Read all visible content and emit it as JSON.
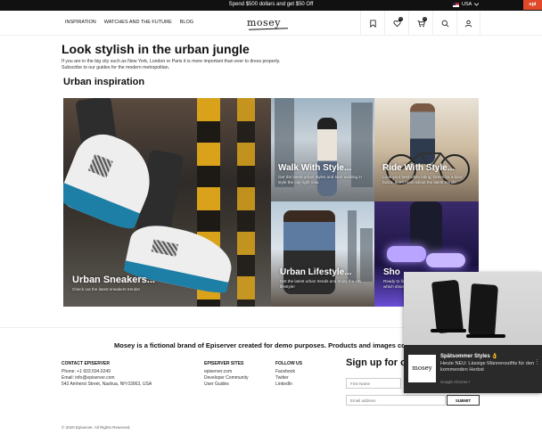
{
  "promo": {
    "text": "Spend $500 dollars and get $50 Off",
    "locale": "USA",
    "ext_badge": "epi"
  },
  "header": {
    "nav": [
      "INSPIRATION",
      "WATCHES AND THE FUTURE",
      "BLOG"
    ],
    "logo": "mosey",
    "wishlist_count": "0",
    "cart_count": "0"
  },
  "hero": {
    "title": "Look stylish in the urban jungle",
    "intro": "If you are in the big city such as New York, London or Paris it is more important than ever to dress properly. Subscribe to our guides for the modern metropolitan.",
    "section_title": "Urban inspiration"
  },
  "tiles": [
    {
      "title": "Urban Sneakers...",
      "subtitle": "Check out the latest sneakers trends!"
    },
    {
      "title": "Walk With Style...",
      "subtitle": "Get the latest urban styles and start walking in style the city right now."
    },
    {
      "title": "Ride With Style...",
      "subtitle": "Look your best while riding. Dress for a bike factor, learn more about the latest trends."
    },
    {
      "title": "Urban Lifestyle...",
      "subtitle": "Get the latest urban trends and enjoy the city lifestyle!"
    },
    {
      "title": "Sho",
      "subtitle": "Ready to find out the latest trends? I find out which shoes..."
    }
  ],
  "footer": {
    "tagline": "Mosey is a fictional brand of Episerver created for demo purposes.  Products and images copyright",
    "contact": {
      "heading": "CONTACT EPISERVER",
      "phone": "Phone: +1 603.594.0249",
      "email": "Email: info@episerver.com",
      "address": "542 Amherst Street, Nashua, NH 03063, USA"
    },
    "sites": {
      "heading": "EPISERVER SITES",
      "links": [
        "episerver.com",
        "Developer Community",
        "User Guides"
      ]
    },
    "follow": {
      "heading": "FOLLOW US",
      "links": [
        "Facebook",
        "Twitter",
        "LinkedIn"
      ]
    },
    "signup": {
      "heading": "Sign up for o",
      "first_name_placeholder": "First Name",
      "email_placeholder": "Email address",
      "submit_label": "SUBMIT"
    },
    "copyright": "© 2020 Episerver. All Rights Reserved."
  },
  "notification": {
    "logo": "mosey",
    "title": "Spätsommer Styles 👌",
    "body": "Heute NEU: Lässige Männeroutfits für den kommenden Herbst",
    "source": "Google Chrome •"
  }
}
